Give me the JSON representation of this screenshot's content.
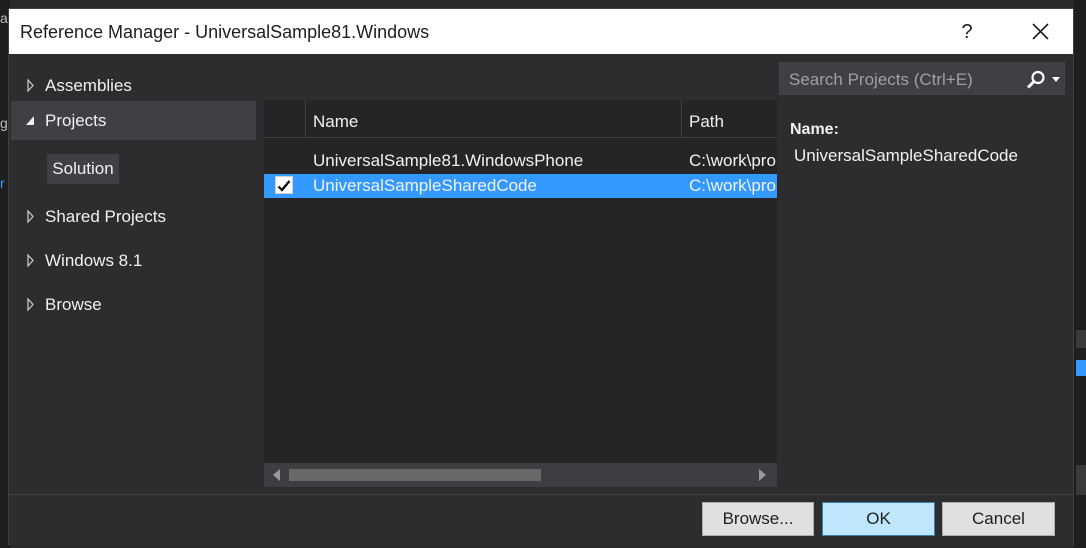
{
  "dialog": {
    "title": "Reference Manager - UniversalSample81.Windows",
    "help_label": "?"
  },
  "nav": {
    "items": [
      {
        "label": "Assemblies",
        "expanded": false
      },
      {
        "label": "Projects",
        "expanded": true
      },
      {
        "label": "Shared Projects",
        "expanded": false
      },
      {
        "label": "Windows 8.1",
        "expanded": false
      },
      {
        "label": "Browse",
        "expanded": false
      }
    ],
    "sub_item": "Solution"
  },
  "search": {
    "placeholder": "Search Projects (Ctrl+E)"
  },
  "grid": {
    "columns": [
      "",
      "Name",
      "Path"
    ],
    "rows": [
      {
        "checked": false,
        "selected": false,
        "name": "UniversalSample81.WindowsPhone",
        "path": "C:\\work\\pro"
      },
      {
        "checked": true,
        "selected": true,
        "name": "UniversalSampleSharedCode",
        "path": "C:\\work\\pro"
      }
    ]
  },
  "details": {
    "label": "Name:",
    "value": "UniversalSampleSharedCode"
  },
  "buttons": {
    "browse": "Browse...",
    "ok": "OK",
    "cancel": "Cancel"
  },
  "colors": {
    "selection": "#3399ff",
    "dialog_bg": "#2d2d30",
    "ok_button": "#bee6fd"
  },
  "icons": [
    "close-icon",
    "search-icon",
    "dropdown-icon",
    "expand-arrow-icon",
    "collapse-arrow-icon",
    "checkmark-icon",
    "scroll-left-icon",
    "scroll-right-icon"
  ]
}
